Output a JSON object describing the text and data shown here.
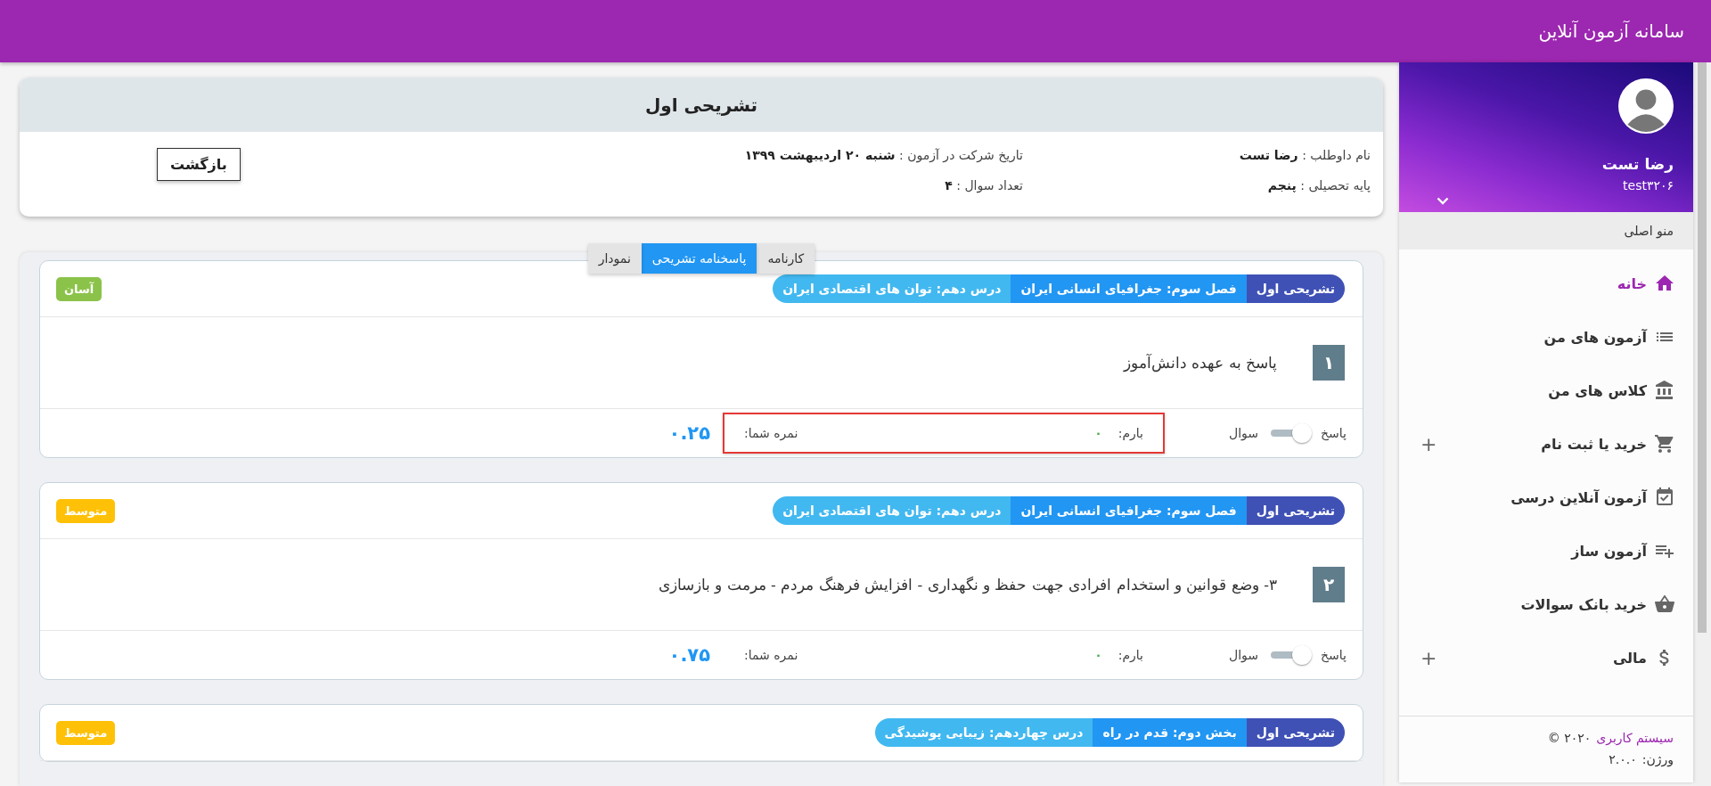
{
  "app_title": "سامانه آزمون آنلاین",
  "user": {
    "name": "رضا تست",
    "username": "test۳۲۰۶"
  },
  "sidebar": {
    "section_title": "منو اصلی",
    "items": [
      {
        "label": "خانه",
        "kind": "home",
        "selected": true
      },
      {
        "label": "آزمون های من",
        "kind": "list",
        "selected": false
      },
      {
        "label": "کلاس های من",
        "kind": "bank",
        "selected": false
      },
      {
        "label": "خرید یا ثبت نام",
        "kind": "cart",
        "selected": false,
        "expand_symbol": "+"
      },
      {
        "label": "آزمون آنلاین درسی",
        "kind": "calendar",
        "selected": false
      },
      {
        "label": "آزمون ساز",
        "kind": "playlist",
        "selected": false
      },
      {
        "label": "خرید بانک سوالات",
        "kind": "basket",
        "selected": false
      },
      {
        "label": "مالی",
        "kind": "dollar",
        "selected": false,
        "expand_symbol": "+"
      }
    ],
    "footer": {
      "brand": "سیستم کاربری",
      "year": "۲۰۲۰ ©",
      "version_label": "ورژن:",
      "version": "۲.۰.۰"
    }
  },
  "exam": {
    "title": "تشریحی اول",
    "fields": [
      {
        "label": "نام داوطلب :",
        "value": "رضا تست"
      },
      {
        "label": "تاریخ شرکت در آزمون :",
        "value": "شنبه ۲۰ اردیبهشت ۱۳۹۹"
      },
      {
        "label": "پایه تحصیلی :",
        "value": "پنجم"
      },
      {
        "label": "تعداد سوال :",
        "value": "۴"
      }
    ],
    "back_button": "بازگشت"
  },
  "tabs": [
    {
      "label": "کارنامه",
      "selected": false
    },
    {
      "label": "پاسخنامه تشریحی",
      "selected": true
    },
    {
      "label": "نمودار",
      "selected": false
    }
  ],
  "questions": [
    {
      "tags": [
        {
          "text": "تشریحی اول",
          "color": "#3f51b5"
        },
        {
          "text": "فصل سوم: جغرافیای انسانی ایران",
          "color": "#2196f3"
        },
        {
          "text": "درس دهم: توان های اقتصادی ایران",
          "color": "#42b8f0"
        }
      ],
      "difficulty": {
        "text": "آسان",
        "color": "#8bc34a"
      },
      "number": "۱",
      "text": "پاسخ به عهده دانش‌آموز",
      "toggle": {
        "answer_label": "پاسخ",
        "question_label": "سوال",
        "on": false
      },
      "barem_label": "بارم:",
      "barem": "۰",
      "grade_label": "نمره شما:",
      "grade": "۰.۲۵",
      "highlighted": true
    },
    {
      "tags": [
        {
          "text": "تشریحی اول",
          "color": "#3f51b5"
        },
        {
          "text": "فصل سوم: جغرافیای انسانی ایران",
          "color": "#2196f3"
        },
        {
          "text": "درس دهم: توان های اقتصادی ایران",
          "color": "#42b8f0"
        }
      ],
      "difficulty": {
        "text": "متوسط",
        "color": "#ffc107"
      },
      "number": "۲",
      "text": "۳- وضع قوانین و استخدام افرادی جهت حفظ و نگهداری - افزایش فرهنگ مردم - مرمت و بازسازی",
      "toggle": {
        "answer_label": "پاسخ",
        "question_label": "سوال",
        "on": false
      },
      "barem_label": "بارم:",
      "barem": "۰",
      "grade_label": "نمره شما:",
      "grade": "۰.۷۵",
      "highlighted": false
    },
    {
      "tags": [
        {
          "text": "تشریحی اول",
          "color": "#3f51b5"
        },
        {
          "text": "بخش دوم: قدم در راه",
          "color": "#2196f3"
        },
        {
          "text": "درس چهاردهم: زیبایی پوشیدگی",
          "color": "#42b8f0"
        }
      ],
      "difficulty": {
        "text": "متوسط",
        "color": "#ffc107"
      }
    }
  ]
}
